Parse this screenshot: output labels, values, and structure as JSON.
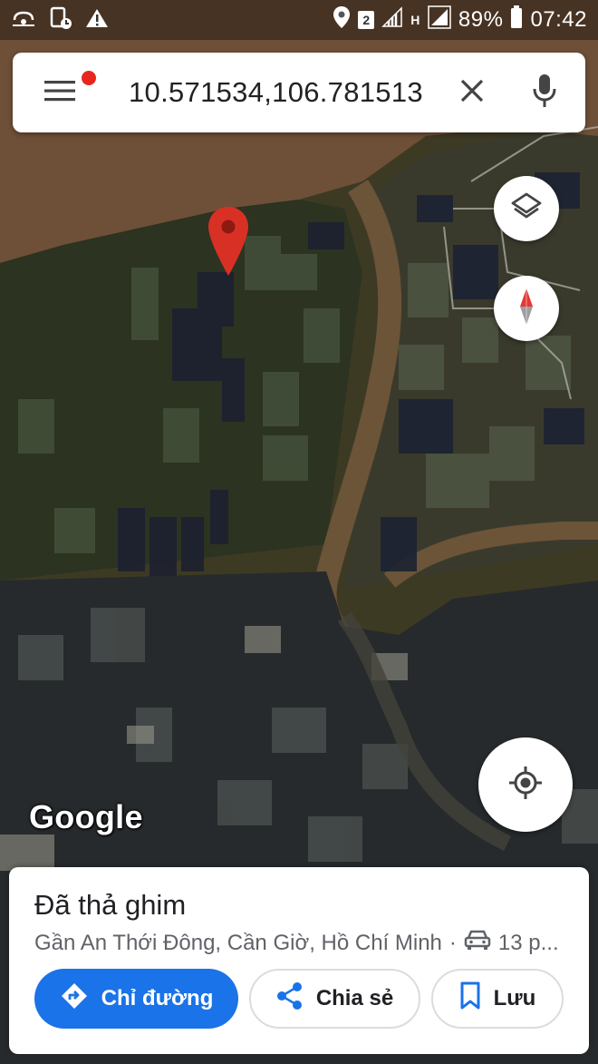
{
  "status_bar": {
    "sim_slot": "2",
    "network_type": "H",
    "battery": "89%",
    "time": "07:42",
    "icons": [
      "hotspot-icon",
      "app-notification-icon",
      "warning-icon",
      "location-icon",
      "signal-icon",
      "battery-icon"
    ]
  },
  "search": {
    "query": "10.571534,106.781513",
    "menu_icon": "hamburger-menu-icon",
    "clear_icon": "close-icon",
    "voice_icon": "microphone-icon"
  },
  "map": {
    "logo": "Google",
    "layers_icon": "layers-icon",
    "compass_icon": "compass-icon",
    "my_location_icon": "my-location-icon",
    "pin_color": "#d93025"
  },
  "place": {
    "title": "Đã thả ghim",
    "address": "Gần An Thới Đông, Cần Giờ, Hồ Chí Minh",
    "separator": "·",
    "travel_icon": "car-icon",
    "duration": "13 p..."
  },
  "actions": {
    "directions_label": "Chỉ đường",
    "share_label": "Chia sẻ",
    "save_label": "Lưu"
  },
  "colors": {
    "accent": "#1a73e8",
    "notification_dot": "#e8261c"
  }
}
